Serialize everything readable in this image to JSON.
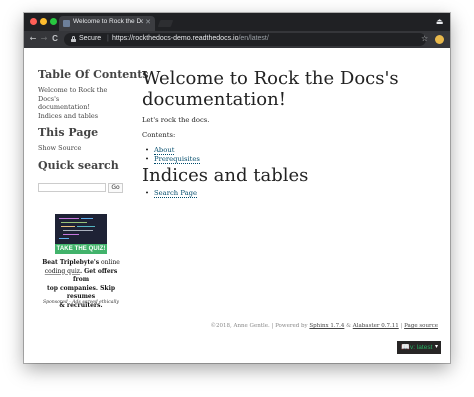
{
  "browser": {
    "tab_title": "Welcome to Rock the Docs's d",
    "tab_close_glyph": "✕",
    "nav_back_glyph": "←",
    "nav_forward_glyph": "→",
    "nav_reload_glyph": "C",
    "secure_label": "Secure",
    "url_separator": "|",
    "url_host": "https://rockthedocs-demo.readthedocs.io",
    "url_path": "/en/latest/",
    "star_glyph": "☆",
    "profile_glyph": "⏏"
  },
  "sidebar": {
    "toc_heading": "Table Of Contents",
    "toc_items": [
      "Welcome to Rock the Docs's",
      "documentation!",
      "Indices and tables"
    ],
    "this_page_heading": "This Page",
    "show_source": "Show Source",
    "quick_search_heading": "Quick search",
    "search_input_value": "",
    "go_label": "Go"
  },
  "ad": {
    "button_label": "TAKE THE QUIZ!",
    "line1_prefix": "Beat ",
    "brand": "Triplebyte's",
    "line1_suffix": " online",
    "link_text": "coding quiz",
    "line2_rest": ". Get offers from",
    "line3": "top companies. Skip resumes",
    "line4": "& recruiters.",
    "sponsored": "Sponsored · Ads served ethically",
    "colors": {
      "bg": "#1e2235",
      "button": "#42b36b"
    }
  },
  "main": {
    "title": "Welcome to Rock the Docs's documentation!",
    "intro": "Let's rock the docs.",
    "contents_label": "Contents:",
    "contents_items": [
      "About",
      "Prerequisites"
    ],
    "indices_heading": "Indices and tables",
    "indices_items": [
      "Search Page"
    ]
  },
  "footer": {
    "copyright": "©2018, Anne Gentle.",
    "separator": "|",
    "powered_by": "Powered by",
    "sphinx": "Sphinx 1.7.4",
    "amp": "&",
    "alabaster": "Alabaster 0.7.11",
    "page_source": "Page source"
  },
  "rtd": {
    "book_glyph": "📖",
    "version": "v: latest",
    "caret_glyph": "▾"
  }
}
